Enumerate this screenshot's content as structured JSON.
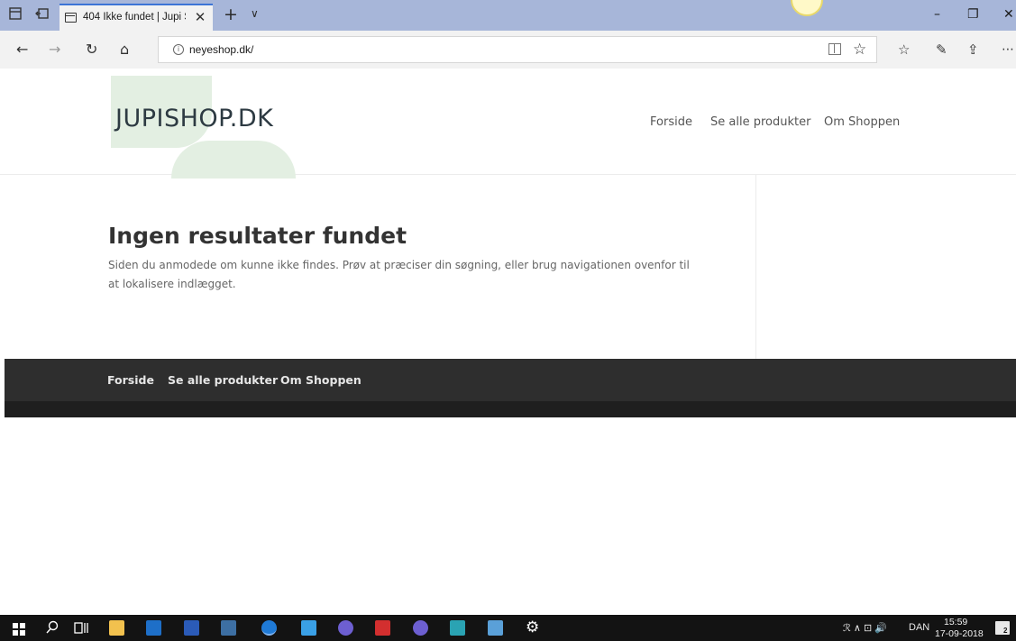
{
  "browser": {
    "tab_title": "404 Ikke fundet | Jupi Sl",
    "tab_close_glyph": "✕",
    "new_tab_glyph": "+",
    "tab_list_glyph": "∨",
    "url": "neyeshop.dk/",
    "win_min": "–",
    "win_max": "❐",
    "win_close": "✕",
    "nav_back": "←",
    "nav_forward": "→",
    "nav_refresh": "↻",
    "nav_home": "⌂",
    "url_info": "i",
    "star": "☆",
    "favorites": "☆",
    "pen": "✎",
    "share": "⇪",
    "more": "⋯"
  },
  "site": {
    "logo": "JUPISHOP.DK",
    "menu": [
      "Forside",
      "Se alle produkter",
      "Om Shoppen"
    ],
    "not_found_title": "Ingen resultater fundet",
    "not_found_text": "Siden du anmodede om kunne ikke findes. Prøv at præciser din søgning, eller brug navigationen ovenfor til at lokalisere indlægget.",
    "footer_menu": [
      "Forside",
      "Se alle produkter",
      "Om Shoppen"
    ]
  },
  "taskbar": {
    "tray_lang": "DAN",
    "tray_symbols": "ℛ  ∧  ⊡  🔊",
    "time": "15:59",
    "date": "17-09-2018",
    "notification_count": "2"
  },
  "colors": {
    "tabbar": "#a7b6d9",
    "footer": "#2e2e2e",
    "logo_accent": "#e3efe2",
    "taskbar": "#131313"
  }
}
